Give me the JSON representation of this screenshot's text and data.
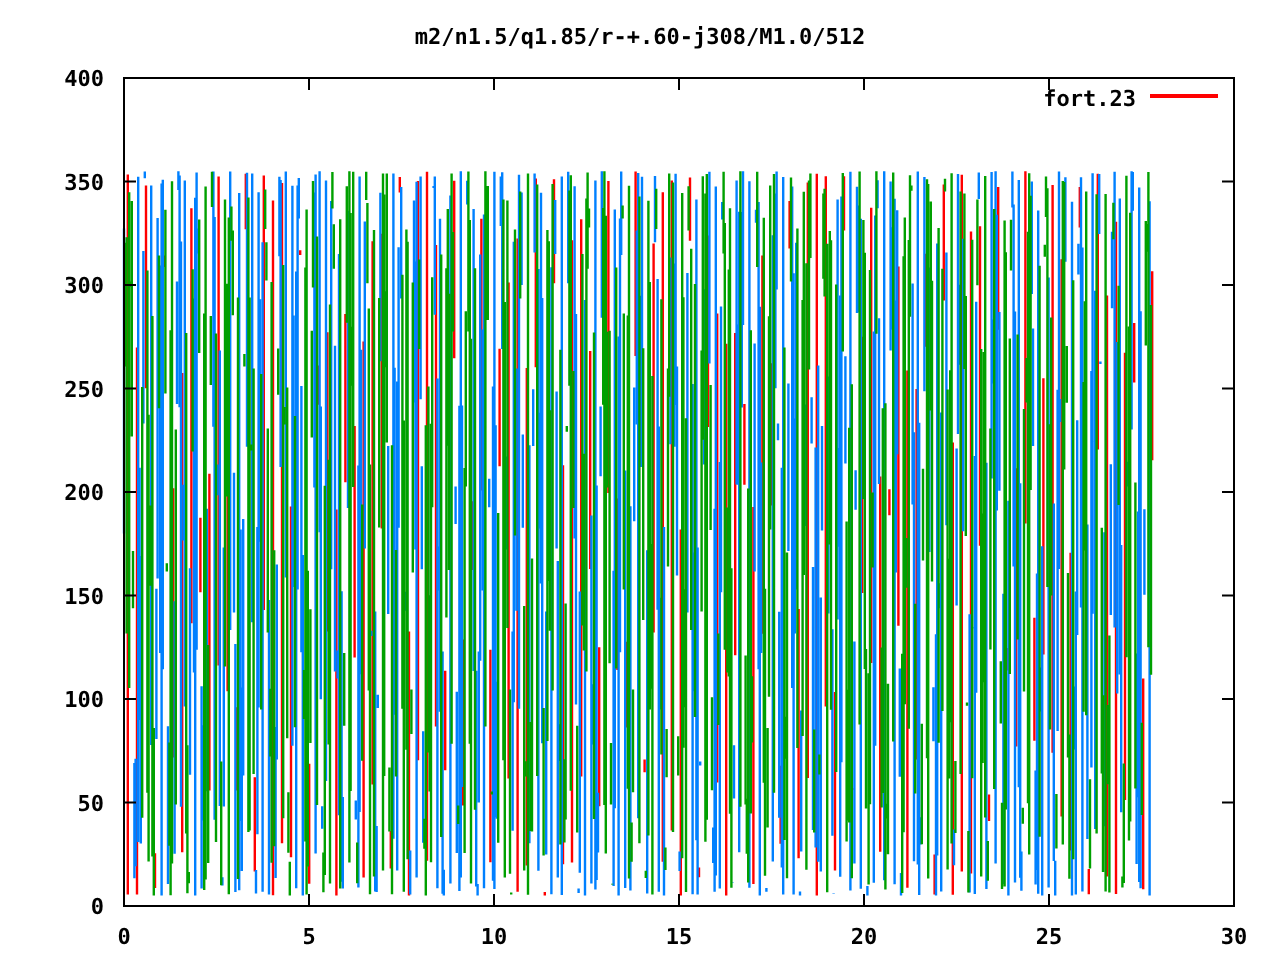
{
  "title": "m2/n1.5/q1.85/r-+.60-j308/M1.0/512",
  "legend": {
    "label": "fort.23",
    "color": "#ff0000"
  },
  "x_axis": {
    "ticks": [
      "0",
      "5",
      "10",
      "15",
      "20",
      "25",
      "30"
    ]
  },
  "y_axis": {
    "ticks": [
      "400",
      "350",
      "300",
      "250",
      "200",
      "150",
      "100",
      "50",
      "0"
    ]
  }
}
